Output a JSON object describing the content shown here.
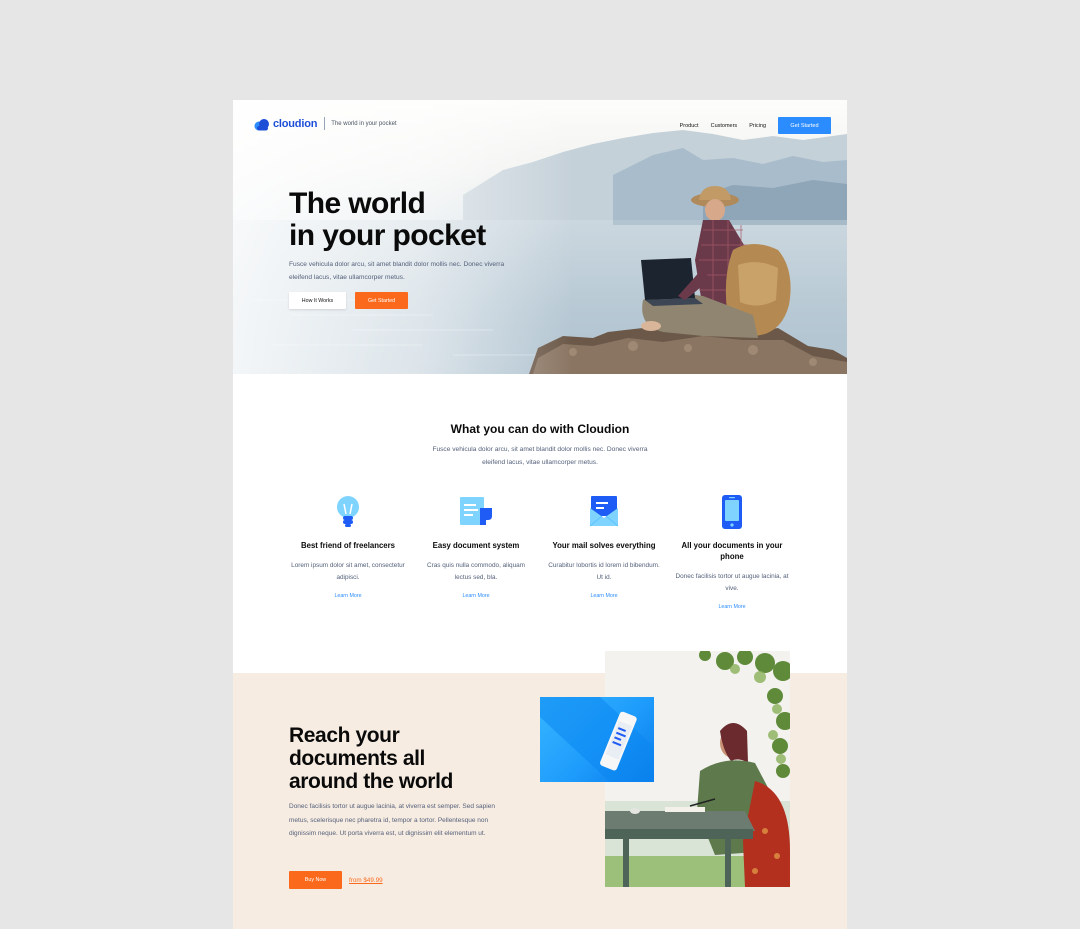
{
  "nav": {
    "brand": "cloudion",
    "tagline": "The world in your pocket",
    "links": [
      "Product",
      "Customers",
      "Pricing"
    ],
    "cta": "Get Started"
  },
  "hero": {
    "title_line1": "The world",
    "title_line2": "in your pocket",
    "subtitle": "Fusce vehicula dolor arcu, sit amet blandit dolor mollis nec. Donec viverra eleifend lacus, vitae ullamcorper metus.",
    "btn_secondary": "How It Works",
    "btn_primary": "Get Started"
  },
  "features": {
    "title": "What you can do with Cloudion",
    "subtitle": "Fusce vehicula dolor arcu, sit amet blandit dolor mollis nec. Donec viverra eleifend lacus, vitae ullamcorper metus.",
    "items": [
      {
        "icon": "lightbulb-icon",
        "title": "Best friend of freelancers",
        "desc": "Lorem ipsum dolor sit amet, consectetur adipisci.",
        "link": "Learn More"
      },
      {
        "icon": "document-icon",
        "title": "Easy document system",
        "desc": "Cras quis nulla commodo, aliquam lectus sed, bla.",
        "link": "Learn More"
      },
      {
        "icon": "mail-icon",
        "title": "Your mail solves everything",
        "desc": "Curabitur lobortis id lorem id bibendum. Ut id.",
        "link": "Learn More"
      },
      {
        "icon": "phone-icon",
        "title": "All your documents in your phone",
        "desc": "Donec facilisis tortor ut augue lacinia, at vive.",
        "link": "Learn More"
      }
    ]
  },
  "reach": {
    "title": "Reach your documents all around the world",
    "text": "Donec facilisis tortor ut augue lacinia, at viverra est semper. Sed sapien metus, scelerisque nec pharetra id, tempor a tortor. Pellentesque non dignissim neque. Ut porta viverra est, ut dignissim elit elementum ut.",
    "btn": "Buy Now",
    "price": "from $49.99"
  },
  "colors": {
    "accent_blue": "#2b8cff",
    "accent_orange": "#fb6a1c",
    "brand_blue": "#1d4ed8",
    "section_beige": "#f7ece2"
  }
}
